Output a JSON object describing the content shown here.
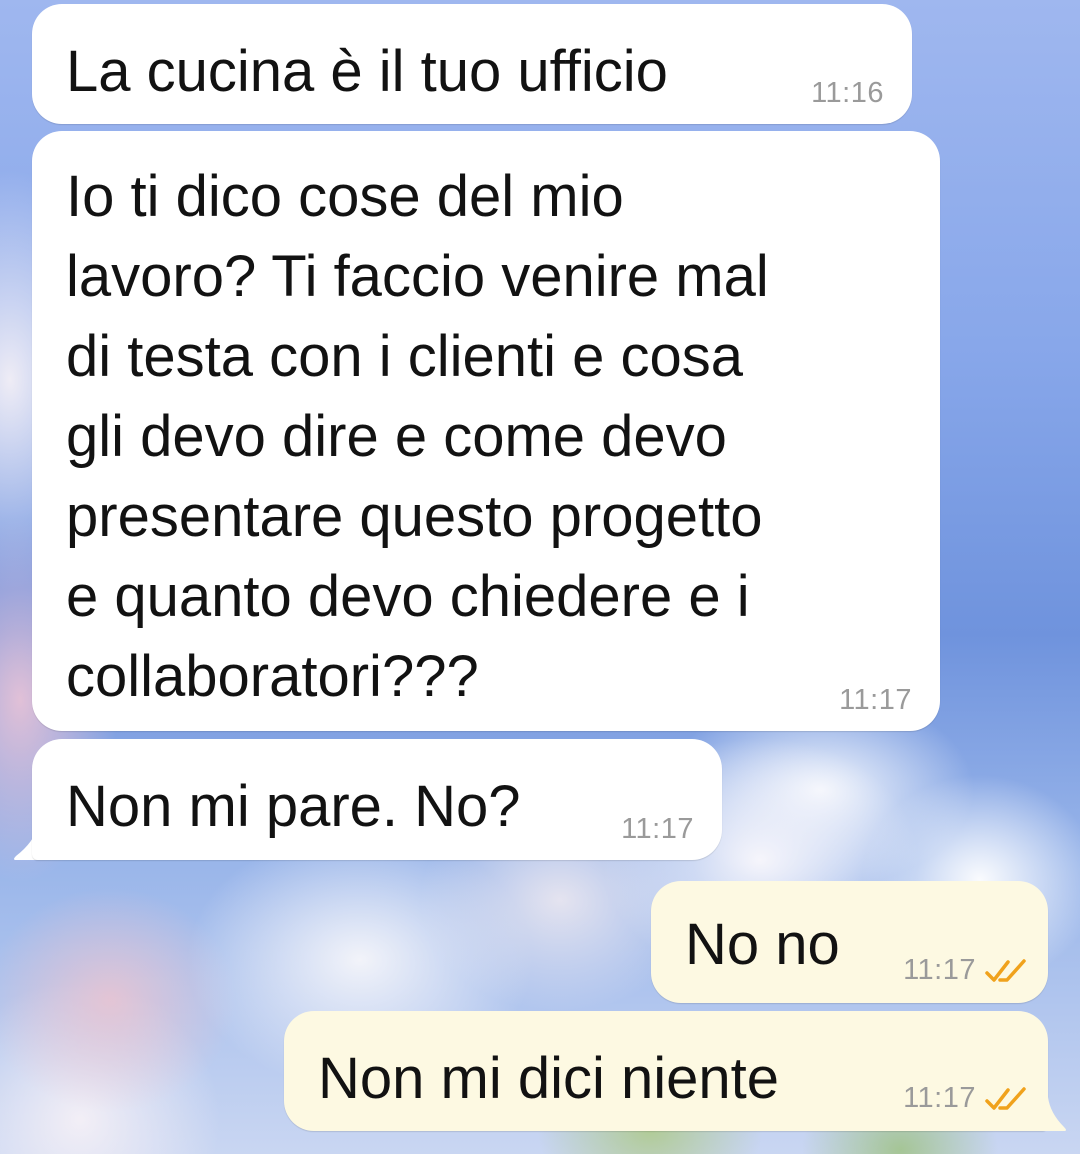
{
  "chat": {
    "messages": [
      {
        "direction": "incoming",
        "text": "La cucina è il tuo ufficio",
        "time": "11:16"
      },
      {
        "direction": "incoming",
        "text": "Io ti dico cose del mio\nlavoro? Ti faccio venire mal\ndi testa con i clienti e cosa\ngli devo dire e come devo\npresentare questo progetto\ne quanto devo chiedere e i\ncollaboratori???",
        "time": "11:17"
      },
      {
        "direction": "incoming",
        "text": "Non mi pare. No?",
        "time": "11:17"
      },
      {
        "direction": "outgoing",
        "text": "No no",
        "time": "11:17",
        "status_icon": "double-check-read-icon"
      },
      {
        "direction": "outgoing",
        "text": "Non mi dici niente",
        "time": "11:17",
        "status_icon": "double-check-read-icon"
      }
    ]
  },
  "colors": {
    "incoming_bubble": "#ffffff",
    "outgoing_bubble": "#fdf9e2",
    "read_check": "#f0a21c",
    "timestamp": "#9a9a9a"
  }
}
